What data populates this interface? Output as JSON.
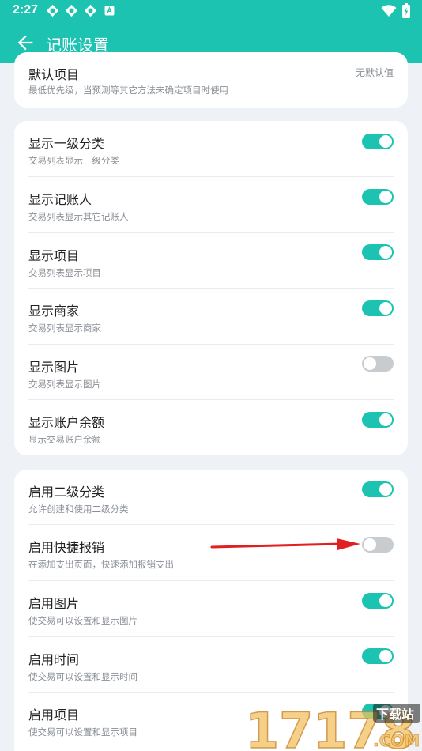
{
  "status_bar": {
    "time": "2:27",
    "notification_icons": [
      "app-notification-icon",
      "app-notification-icon",
      "app-notification-icon",
      "a-notification-icon"
    ],
    "right_icons": [
      "wifi-icon",
      "battery-icon"
    ]
  },
  "appbar": {
    "title": "记账设置"
  },
  "colors": {
    "accent": "#1cc3b1",
    "switch_off": "#c9cccf",
    "background": "#eef2f6",
    "arrow": "#e02020"
  },
  "card1": {
    "row": {
      "title": "默认项目",
      "subtitle": "最低优先级，当预测等其它方法未确定项目时使用",
      "value": "无默认值"
    }
  },
  "card2": {
    "rows": [
      {
        "title": "显示一级分类",
        "subtitle": "交易列表显示一级分类",
        "on": true
      },
      {
        "title": "显示记账人",
        "subtitle": "交易列表显示其它记账人",
        "on": true
      },
      {
        "title": "显示项目",
        "subtitle": "交易列表显示项目",
        "on": true
      },
      {
        "title": "显示商家",
        "subtitle": "交易列表显示商家",
        "on": true
      },
      {
        "title": "显示图片",
        "subtitle": "交易列表显示图片",
        "on": false
      },
      {
        "title": "显示账户余额",
        "subtitle": "显示交易账户余额",
        "on": true
      }
    ]
  },
  "card3": {
    "rows": [
      {
        "title": "启用二级分类",
        "subtitle": "允许创建和使用二级分类",
        "on": true
      },
      {
        "title": "启用快捷报销",
        "subtitle": "在添加支出页面，快速添加报销支出",
        "on": false
      },
      {
        "title": "启用图片",
        "subtitle": "使交易可以设置和显示图片",
        "on": true
      },
      {
        "title": "启用时间",
        "subtitle": "使交易可以设置和显示时间",
        "on": true
      },
      {
        "title": "启用项目",
        "subtitle": "使交易可以设置和显示项目",
        "on": true
      }
    ]
  },
  "watermark": {
    "number": "17178",
    "tag": "下载站",
    "suffix": ".COM"
  }
}
